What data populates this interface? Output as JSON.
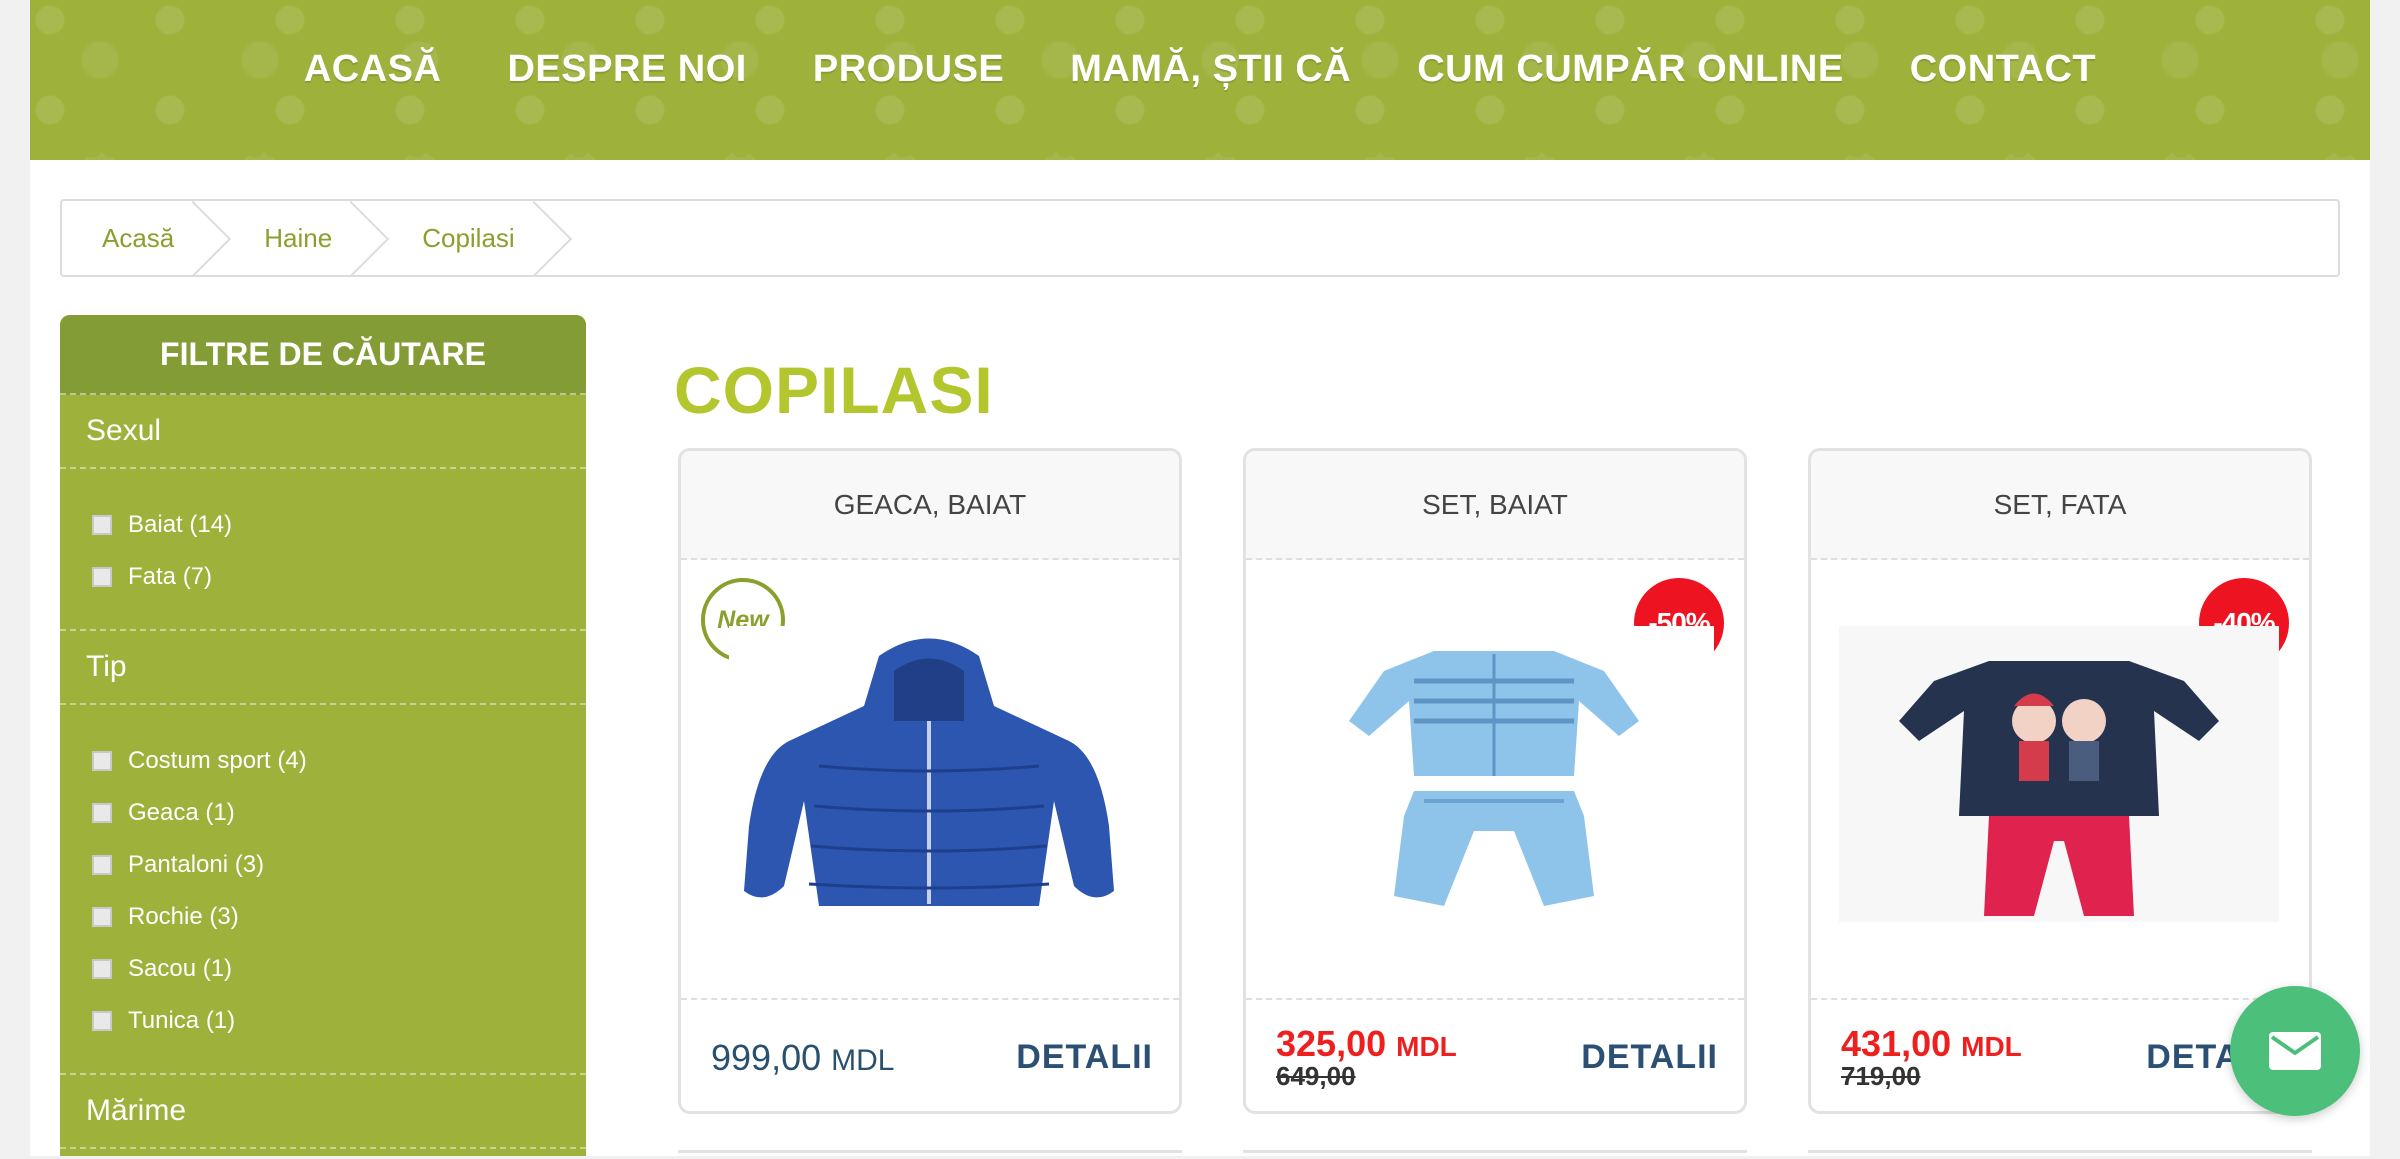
{
  "nav": {
    "items": [
      "ACASĂ",
      "DESPRE NOI",
      "PRODUSE",
      "MAMĂ, ȘTII CĂ",
      "CUM CUMPĂR ONLINE",
      "CONTACT"
    ]
  },
  "breadcrumb": [
    "Acasă",
    "Haine",
    "Copilasi"
  ],
  "sidebar": {
    "title": "FILTRE DE CĂUTARE",
    "sections": [
      {
        "label": "Sexul",
        "items": [
          "Baiat (14)",
          "Fata (7)"
        ]
      },
      {
        "label": "Tip",
        "items": [
          "Costum sport (4)",
          "Geaca (1)",
          "Pantaloni (3)",
          "Rochie (3)",
          "Sacou (1)",
          "Tunica (1)"
        ]
      },
      {
        "label": "Mărime",
        "items": []
      }
    ]
  },
  "main": {
    "title": "COPILASI",
    "products": [
      {
        "name": "GEACA, BAIAT",
        "badge": "New",
        "price": "999,00",
        "currency": "MDL",
        "old_price": "",
        "details_label": "DETALII",
        "icon": "jacket-image"
      },
      {
        "name": "SET, BAIAT",
        "badge": "-50%",
        "price": "325,00",
        "currency": "MDL",
        "old_price": "649,00",
        "details_label": "DETALII",
        "icon": "boy-set-image"
      },
      {
        "name": "SET, FATA",
        "badge": "-40%",
        "price": "431,00",
        "currency": "MDL",
        "old_price": "719,00",
        "details_label": "DETALII",
        "icon": "girl-set-image"
      }
    ]
  },
  "colors": {
    "brand_green": "#9db13b",
    "title_green": "#b3c62d",
    "sale_red": "#ee1f1f",
    "chat_green": "#4cbf7b"
  },
  "chat": {
    "icon": "envelope-icon"
  }
}
